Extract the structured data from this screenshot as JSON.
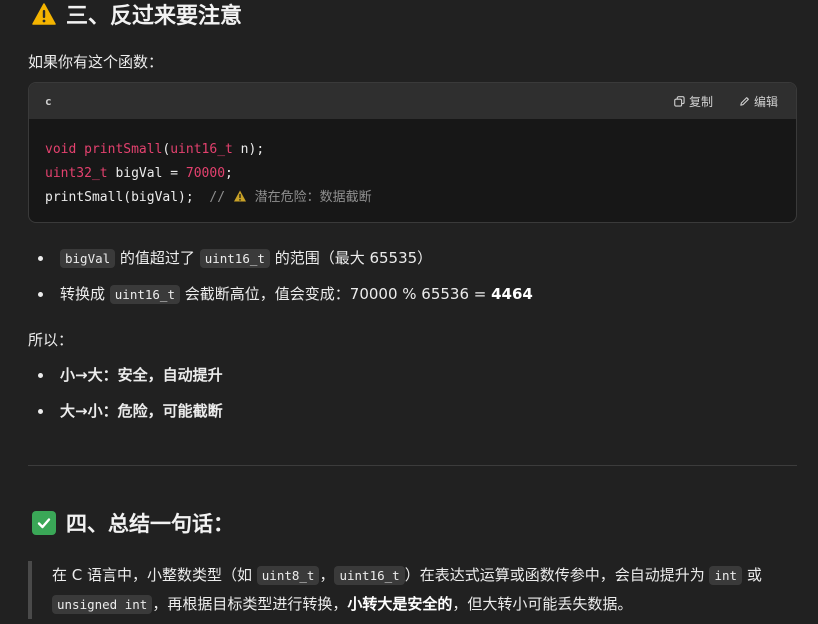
{
  "section3": {
    "icon": "warning-icon",
    "title": "三、反过来要注意"
  },
  "intro": "如果你有这个函数：",
  "code_block": {
    "language": "c",
    "copy_label": "复制",
    "edit_label": "编辑",
    "lines": [
      {
        "kw1": "void printSmall",
        "mid": "(",
        "kw2": "uint16_t",
        "rest": " n);"
      },
      {
        "kw1": "uint32_t",
        "mid": " bigVal = ",
        "num": "70000",
        "rest": ";"
      },
      {
        "plain": "printSmall(bigVal);  ",
        "comment_slashes": "//",
        "comment": " 潜在危险：数据截断"
      }
    ]
  },
  "bullets1": [
    {
      "code": "bigVal",
      "text_a": " 的值超过了 ",
      "code2": "uint16_t",
      "text_b": " 的范围（最大 65535）"
    },
    {
      "text_a": "转换成 ",
      "code": "uint16_t",
      "text_b": " 会截断高位，值会变成：70000 % 65536 = ",
      "bold": "4464"
    }
  ],
  "so_label": "所以：",
  "bullets2": [
    "小→大：安全，自动提升",
    "大→小：危险，可能截断"
  ],
  "section4": {
    "icon": "check-mark-icon",
    "title": "四、总结一句话："
  },
  "summary": {
    "t1": "在 C 语言中，小整数类型（如 ",
    "c1": "uint8_t",
    "t2": "，",
    "c2": "uint16_t",
    "t3": "）在表达式运算或函数传参中，会自动提升为 ",
    "c3": "int",
    "t4": " 或",
    "c4": "unsigned int",
    "t5": "，再根据目标类型进行转换，",
    "b1": "小转大是安全的",
    "t6": "，但大转小可能丢失数据。"
  }
}
